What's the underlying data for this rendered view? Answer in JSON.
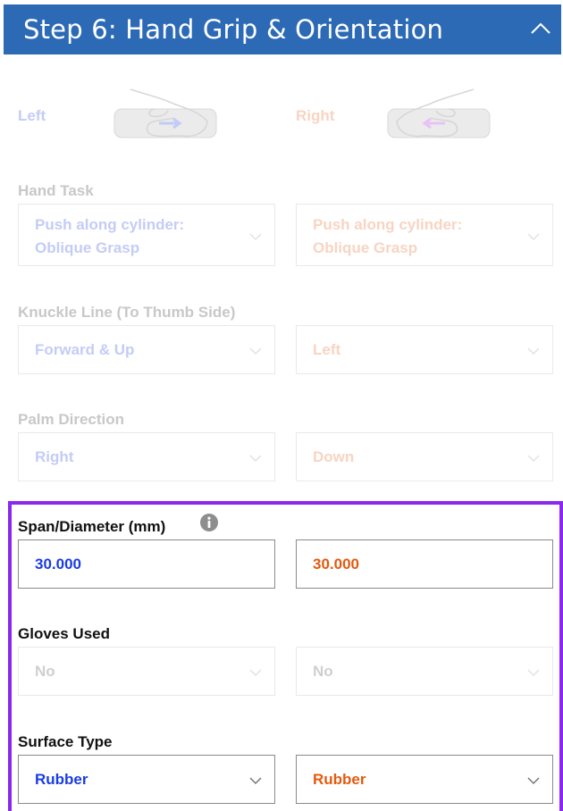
{
  "header": {
    "title": "Step 6: Hand Grip & Orientation"
  },
  "hands": {
    "left_label": "Left",
    "right_label": "Right"
  },
  "hand_task": {
    "label": "Hand Task",
    "left": [
      "Push along cylinder:",
      "Oblique Grasp"
    ],
    "right": [
      "Push along cylinder:",
      "Oblique Grasp"
    ]
  },
  "knuckle_line": {
    "label": "Knuckle Line (To Thumb Side)",
    "left": "Forward & Up",
    "right": "Left"
  },
  "palm_direction": {
    "label": "Palm Direction",
    "left": "Right",
    "right": "Down"
  },
  "span_diameter": {
    "label": "Span/Diameter (mm)",
    "left": "30.000",
    "right": "30.000"
  },
  "gloves_used": {
    "label": "Gloves Used",
    "left": "No",
    "right": "No"
  },
  "surface_type": {
    "label": "Surface Type",
    "left": "Rubber",
    "right": "Rubber"
  },
  "colors": {
    "header_bg": "#2d6ab5",
    "left_accent": "#1a3ce3",
    "right_accent": "#e35a0e",
    "highlight_border": "#8a28f0"
  },
  "icons": [
    "chevron-up-icon",
    "hand-grip-left-icon",
    "hand-grip-right-icon",
    "chevron-down-icon",
    "info-icon"
  ]
}
